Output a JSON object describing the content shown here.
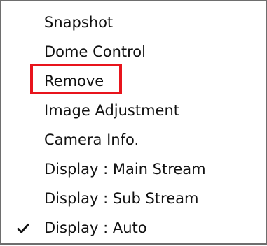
{
  "context_menu": {
    "items": [
      {
        "label": "Snapshot",
        "checked": false
      },
      {
        "label": "Dome Control",
        "checked": false
      },
      {
        "label": "Remove",
        "checked": false,
        "highlighted": true
      },
      {
        "label": "Image Adjustment",
        "checked": false
      },
      {
        "label": "Camera Info.",
        "checked": false
      },
      {
        "label": "Display : Main Stream",
        "checked": false
      },
      {
        "label": "Display : Sub Stream",
        "checked": false
      },
      {
        "label": "Display : Auto",
        "checked": true
      }
    ],
    "check_icon": "checkmark-icon",
    "highlight_color": "#e8141c"
  }
}
